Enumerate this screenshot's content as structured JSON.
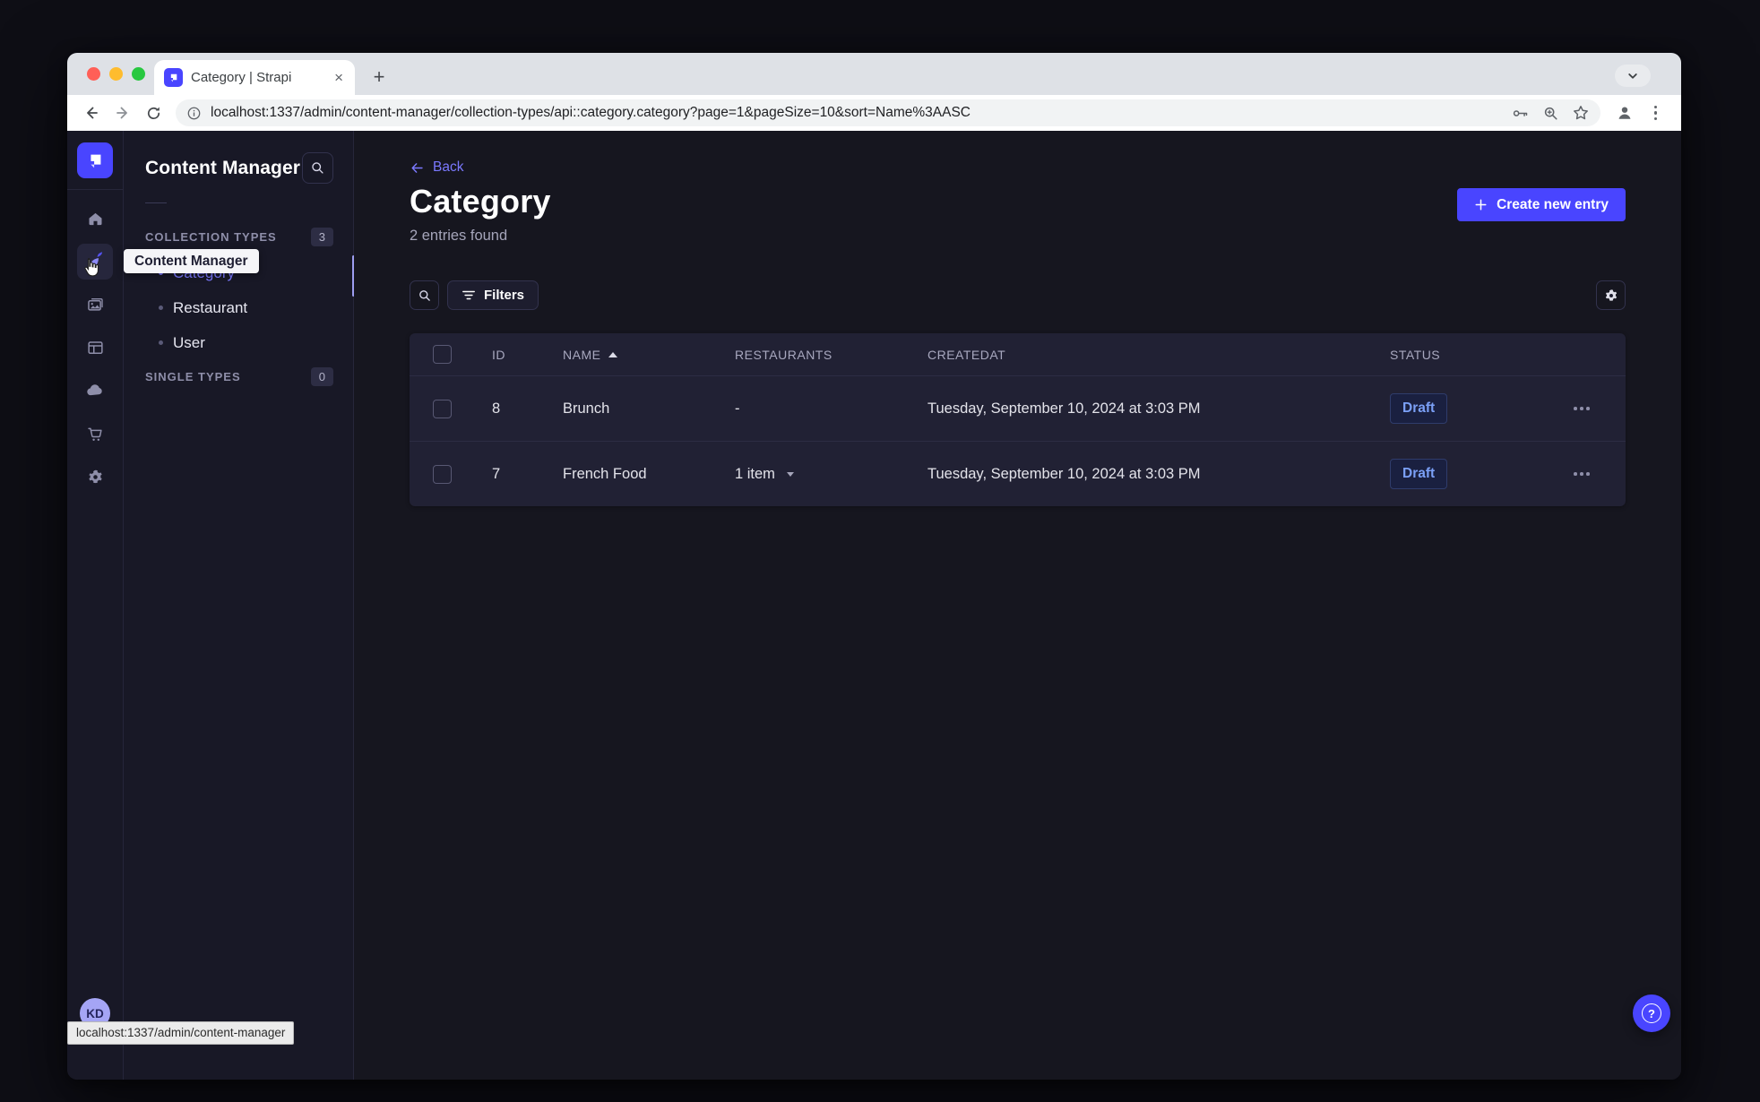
{
  "browser": {
    "tab_title": "Category | Strapi",
    "new_tab_label": "+",
    "url": "localhost:1337/admin/content-manager/collection-types/api::category.category?page=1&pageSize=10&sort=Name%3AASC",
    "status_bubble": "localhost:1337/admin/content-manager"
  },
  "strapi": {
    "nav_tooltip": "Content Manager",
    "avatar_initials": "KD",
    "help_label": "?",
    "panel": {
      "title": "Content Manager",
      "sections": [
        {
          "label": "COLLECTION TYPES",
          "badge": "3",
          "items": [
            {
              "label": "Category",
              "active": true
            },
            {
              "label": "Restaurant",
              "active": false
            },
            {
              "label": "User",
              "active": false
            }
          ]
        },
        {
          "label": "SINGLE TYPES",
          "badge": "0",
          "items": []
        }
      ]
    },
    "page": {
      "back": "Back",
      "title": "Category",
      "subtitle": "2 entries found",
      "create_button": "Create new entry",
      "filters_button": "Filters"
    },
    "table": {
      "headers": {
        "id": "ID",
        "name": "NAME",
        "restaurants": "RESTAURANTS",
        "createdat": "CREATEDAT",
        "status": "STATUS"
      },
      "sort": {
        "column": "NAME",
        "direction": "ASC"
      },
      "rows": [
        {
          "id": "8",
          "name": "Brunch",
          "restaurants": "-",
          "createdat": "Tuesday, September 10, 2024 at 3:03 PM",
          "status": "Draft"
        },
        {
          "id": "7",
          "name": "French Food",
          "restaurants": "1 item",
          "createdat": "Tuesday, September 10, 2024 at 3:03 PM",
          "status": "Draft"
        }
      ]
    },
    "rail_icon_names": [
      "strapi-logo-icon",
      "home-icon",
      "content-manager-icon",
      "media-library-icon",
      "content-type-builder-icon",
      "cloud-icon",
      "marketplace-icon",
      "settings-icon"
    ],
    "colors": {
      "primary": "#4945ff",
      "link": "#7b79ff",
      "draft_text": "#7ba0f7",
      "app_bg": "#181826",
      "surface": "#212134"
    }
  }
}
